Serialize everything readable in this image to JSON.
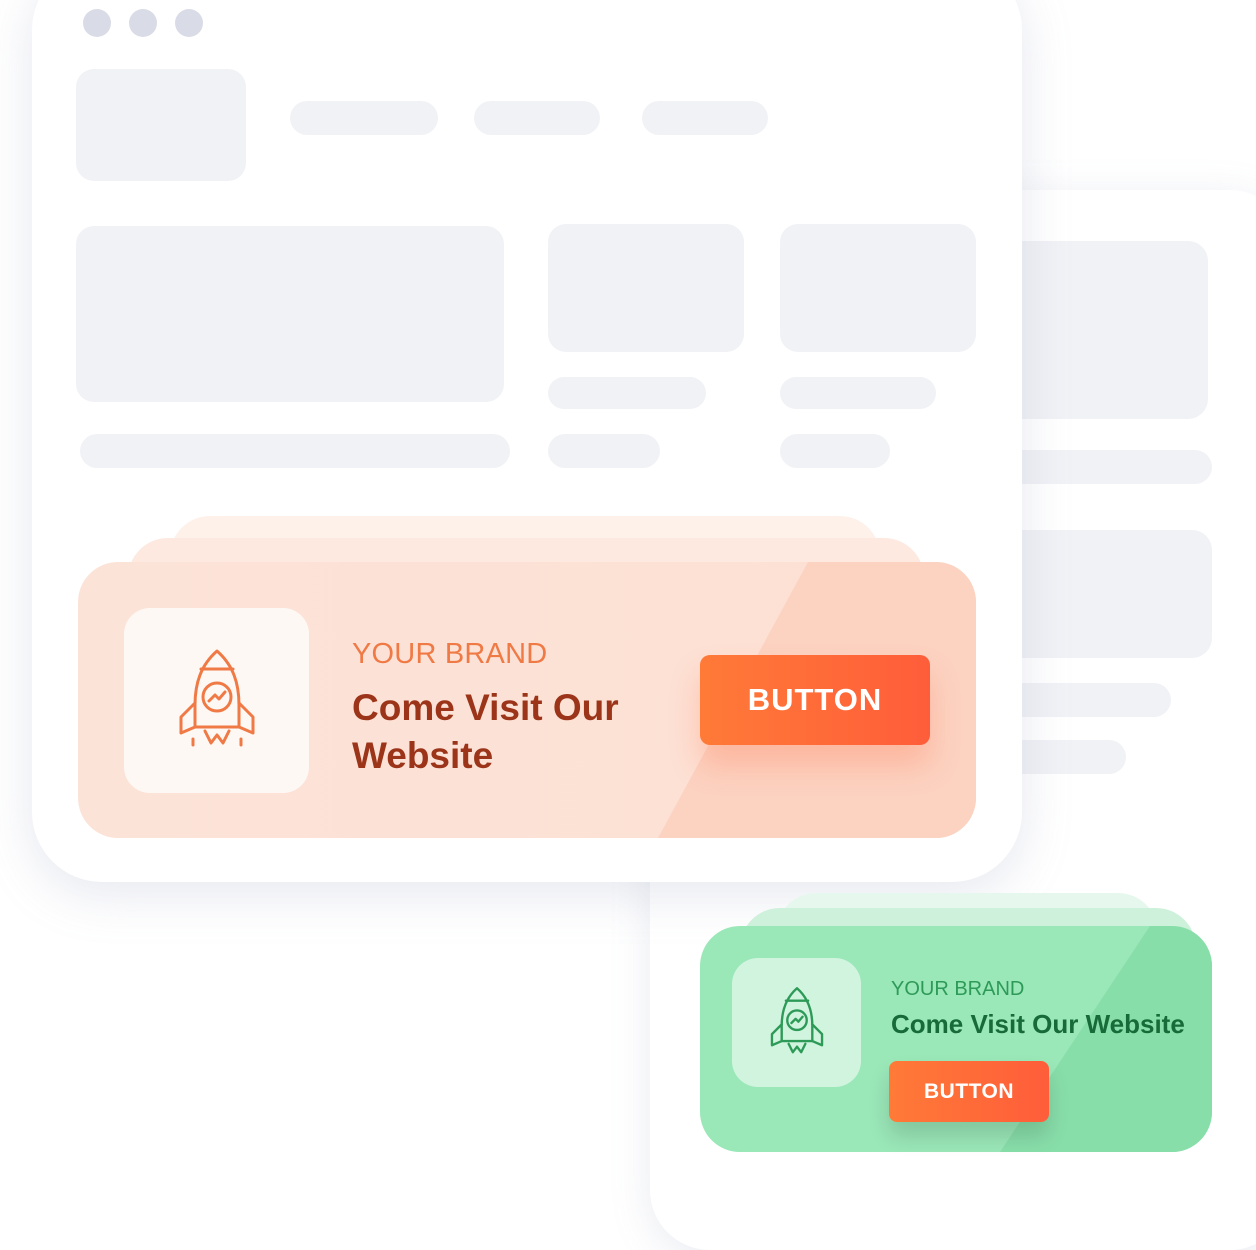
{
  "promo_banner": {
    "brand": "YOUR BRAND",
    "headline": "Come Visit Our Website",
    "button_label": "BUTTON",
    "icon": "rocket-icon",
    "accent_color": "#ff6a38",
    "background_color": "#fde0d3"
  },
  "promo_banner_small": {
    "brand": "YOUR BRAND",
    "headline": "Come Visit Our Website",
    "button_label": "BUTTON",
    "icon": "rocket-icon",
    "accent_color": "#ff6a38",
    "background_color": "#9ae7b8"
  },
  "window": {
    "controls": [
      "dot",
      "dot",
      "dot"
    ],
    "placeholder_color": "#f1f2f6"
  }
}
